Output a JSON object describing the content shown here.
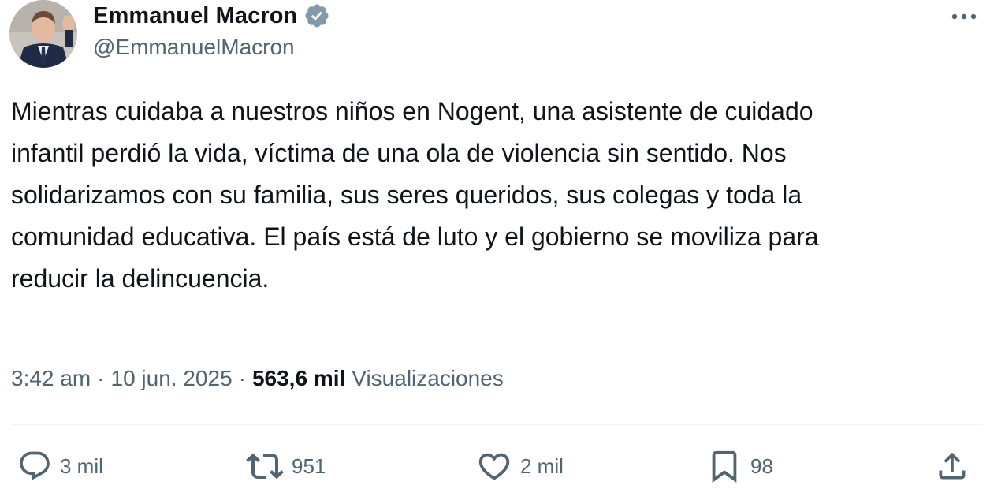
{
  "author": {
    "display_name": "Emmanuel Macron",
    "handle": "@EmmanuelMacron",
    "verified_badge_color": "#829aab"
  },
  "tweet": {
    "text": "Mientras cuidaba a nuestros niños en Nogent, una asistente de cuidado\ninfantil perdió la vida, víctima de una ola de violencia sin sentido. Nos\nsolidarizamos con su familia, sus seres queridos, sus colegas y toda la\ncomunidad educativa. El país está de luto y el gobierno se moviliza para\nreducir la delincuencia."
  },
  "meta": {
    "time": "3:42 am",
    "separator": "·",
    "date": "10 jun. 2025",
    "views_count": "563,6 mil",
    "views_label": "Visualizaciones"
  },
  "actions": {
    "reply": {
      "icon": "reply-icon",
      "count": "3 mil"
    },
    "retweet": {
      "icon": "retweet-icon",
      "count": "951"
    },
    "like": {
      "icon": "heart-icon",
      "count": "2 mil"
    },
    "bookmark": {
      "icon": "bookmark-icon",
      "count": "98"
    },
    "share": {
      "icon": "share-icon"
    }
  },
  "colors": {
    "text_primary": "#0f1419",
    "text_secondary": "#536471",
    "divider": "#eff3f4"
  }
}
